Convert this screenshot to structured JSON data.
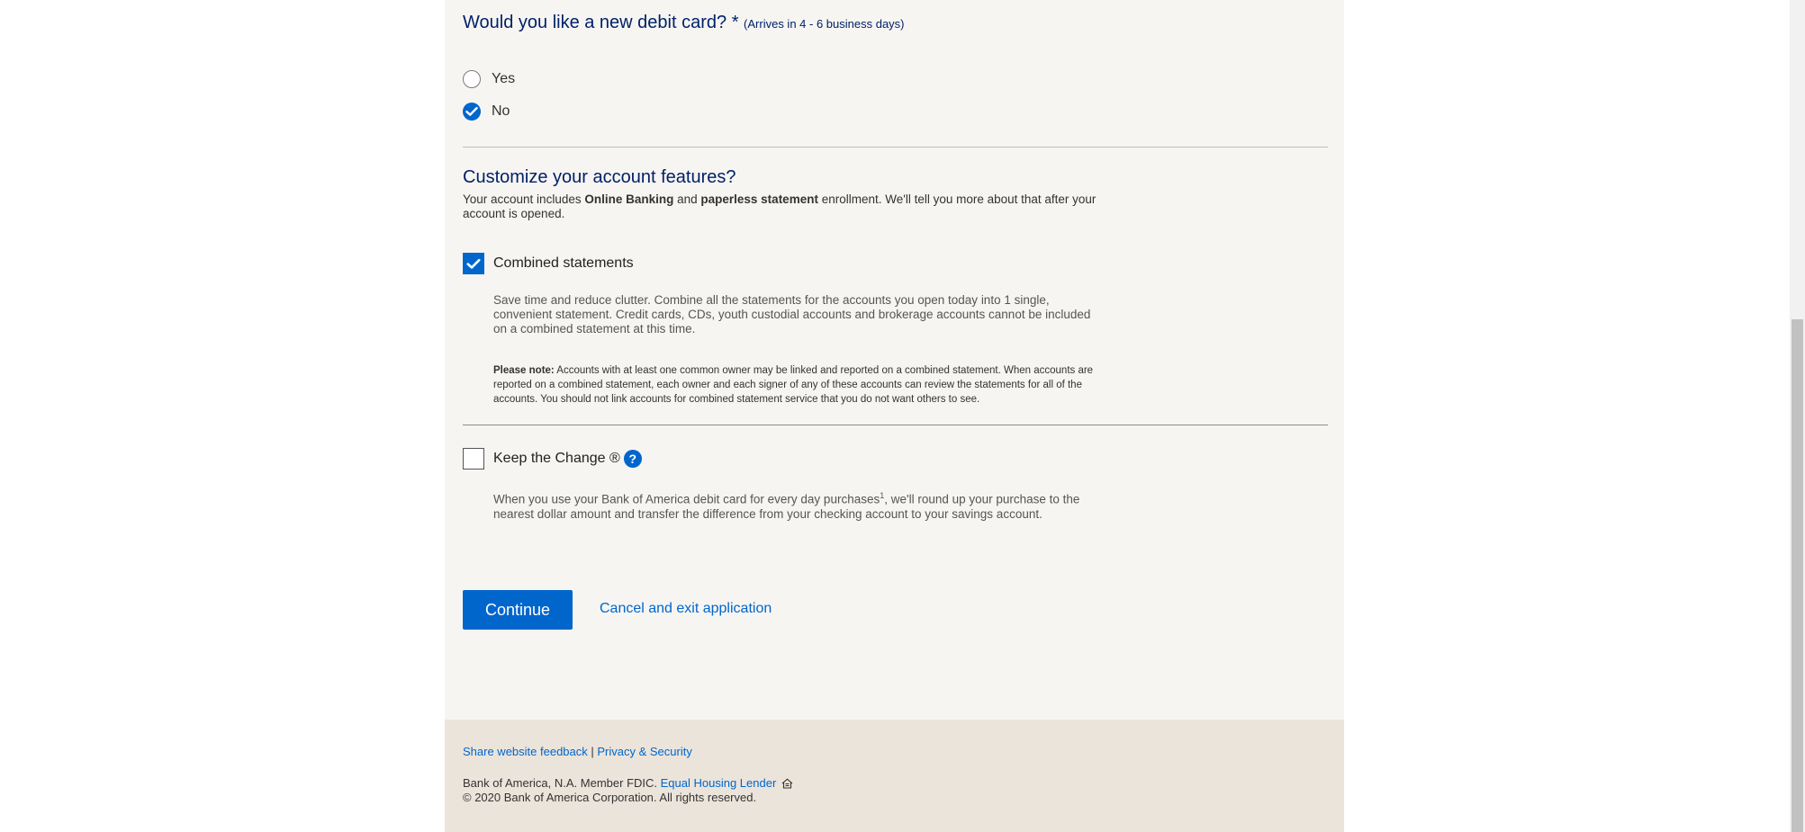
{
  "debit_card": {
    "question": "Would you like a new debit card? *",
    "arrives": "(Arrives in 4 - 6 business days)",
    "options": [
      {
        "label": "Yes",
        "checked": false
      },
      {
        "label": "No",
        "checked": true
      }
    ]
  },
  "customize": {
    "title": "Customize your account features?",
    "desc_pre": "Your account includes ",
    "desc_bold1": "Online Banking",
    "desc_mid": " and ",
    "desc_bold2": "paperless statement",
    "desc_post": " enrollment. We'll tell you more about that after your account is opened."
  },
  "combined": {
    "label": "Combined statements",
    "checked": true,
    "description": "Save time and reduce clutter. Combine all the statements for the accounts you open today into 1 single, convenient statement. Credit cards, CDs, youth custodial accounts and brokerage accounts cannot be included on a combined statement at this time.",
    "note_label": "Please note:",
    "note_text": " Accounts with at least one common owner may be linked and reported on a combined statement. When accounts are reported on a combined statement, each owner and each signer of any of these accounts can review the statements for all of the accounts. You should not link accounts for combined statement service that you do not want others to see."
  },
  "keep_change": {
    "label": "Keep the Change ®",
    "help_icon": "?",
    "checked": false,
    "desc_pre": "When you use your Bank of America debit card for every day purchases",
    "desc_sup": "1",
    "desc_post": ", we'll round up your purchase to the nearest dollar amount and transfer the difference from your checking account to your savings account."
  },
  "actions": {
    "continue_label": "Continue",
    "cancel_label": "Cancel and exit application"
  },
  "footer": {
    "feedback_link": "Share website feedback",
    "separator": " | ",
    "privacy_link": "Privacy & Security",
    "fdic_text": "Bank of America, N.A. Member FDIC. ",
    "housing_link": "Equal Housing Lender",
    "copyright": "© 2020 Bank of America Corporation. All rights reserved."
  },
  "colors": {
    "accent": "#0066cc",
    "heading": "#012169",
    "panel_bg": "#f7f5f2",
    "footer_bg": "#ebe4db"
  },
  "icons": [
    "check-icon",
    "help-icon",
    "equal-housing-icon"
  ]
}
